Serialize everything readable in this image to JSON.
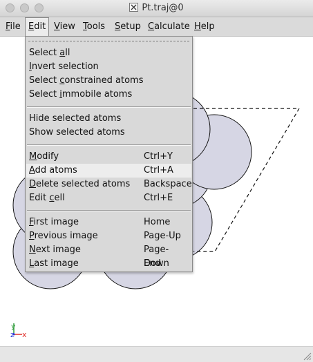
{
  "window": {
    "title": "Pt.traj@0"
  },
  "colors": {
    "atom_fill": "#d6d6e4",
    "atom_stroke": "#111111",
    "axis_x": "#e0302a",
    "axis_y": "#2e9b3a",
    "axis_z": "#2d3bd8"
  },
  "menubar": {
    "file": {
      "label": "File",
      "mnemonic": "F",
      "rest": "ile"
    },
    "edit": {
      "label": "Edit",
      "mnemonic": "E",
      "rest": "dit"
    },
    "view": {
      "label": "View",
      "mnemonic": "V",
      "rest": "iew"
    },
    "tools": {
      "label": "Tools",
      "mnemonic": "T",
      "rest": "ools"
    },
    "setup": {
      "label": "Setup",
      "mnemonic": "S",
      "rest": "etup"
    },
    "calculate": {
      "label": "Calculate",
      "mnemonic": "C",
      "rest": "alculate"
    },
    "help": {
      "label": "Help",
      "mnemonic": "H",
      "rest": "elp"
    }
  },
  "edit_menu": {
    "items": [
      {
        "pre": "Select ",
        "u": "a",
        "post": "ll",
        "accel": ""
      },
      {
        "pre": "",
        "u": "I",
        "post": "nvert selection",
        "accel": ""
      },
      {
        "pre": "Select ",
        "u": "c",
        "post": "onstrained atoms",
        "accel": ""
      },
      {
        "pre": "Select ",
        "u": "i",
        "post": "mmobile atoms",
        "accel": ""
      },
      {
        "pre": "Hide selected atoms",
        "u": "",
        "post": "",
        "accel": ""
      },
      {
        "pre": "Show selected atoms",
        "u": "",
        "post": "",
        "accel": ""
      },
      {
        "pre": "",
        "u": "M",
        "post": "odify",
        "accel": "Ctrl+Y"
      },
      {
        "pre": "",
        "u": "A",
        "post": "dd atoms",
        "accel": "Ctrl+A"
      },
      {
        "pre": "",
        "u": "D",
        "post": "elete selected atoms",
        "accel": "Backspace"
      },
      {
        "pre": "Edit ",
        "u": "c",
        "post": "ell",
        "accel": "Ctrl+E"
      },
      {
        "pre": "",
        "u": "F",
        "post": "irst image",
        "accel": "Home"
      },
      {
        "pre": "",
        "u": "P",
        "post": "revious image",
        "accel": "Page-Up"
      },
      {
        "pre": "",
        "u": "N",
        "post": "ext image",
        "accel": "Page-Down"
      },
      {
        "pre": "",
        "u": "L",
        "post": "ast image",
        "accel": "End"
      }
    ]
  },
  "axes": {
    "x": "x",
    "y": "y",
    "z": "z"
  }
}
